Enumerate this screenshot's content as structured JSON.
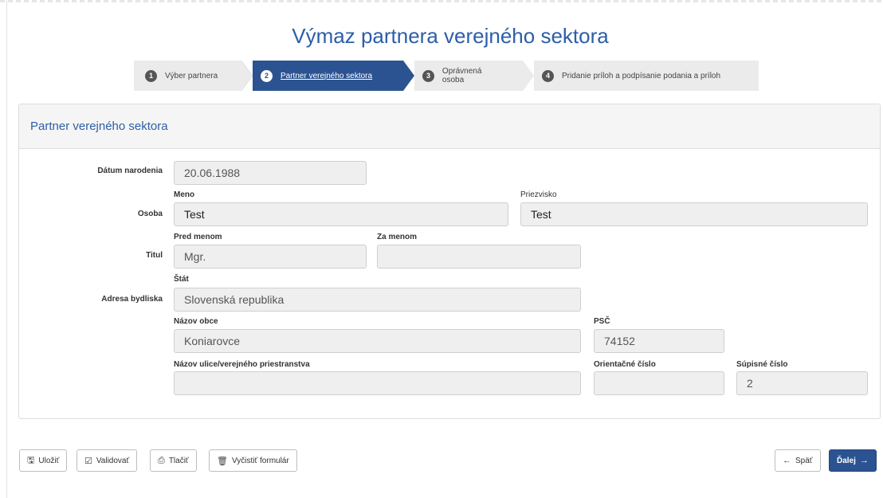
{
  "title": "Výmaz partnera verejného sektora",
  "steps": [
    {
      "num": "1",
      "label": "Výber partnera"
    },
    {
      "num": "2",
      "label": "Partner verejného sektora"
    },
    {
      "num": "3",
      "label": "Oprávnená osoba"
    },
    {
      "num": "4",
      "label": "Pridanie príloh a podpísanie podania a príloh"
    }
  ],
  "section_title": "Partner verejného sektora",
  "form": {
    "birth_date": {
      "label": "Dátum narodenia",
      "value": "20.06.1988"
    },
    "person": {
      "label": "Osoba",
      "first_name_label": "Meno",
      "first_name": "Test",
      "last_name_label": "Priezvisko",
      "last_name": "Test"
    },
    "title": {
      "label": "Titul",
      "before_label": "Pred menom",
      "before": "Mgr.",
      "after_label": "Za menom",
      "after": ""
    },
    "address": {
      "label": "Adresa bydliska",
      "country_label": "Štát",
      "country": "Slovenská republika",
      "municipality_label": "Názov obce",
      "municipality": "Koniarovce",
      "zip_label": "PSČ",
      "zip": "74152",
      "street_label": "Názov ulice/verejného priestranstva",
      "street": "",
      "orientation_no_label": "Orientačné číslo",
      "orientation_no": "",
      "register_no_label": "Súpisné číslo",
      "register_no": "2"
    }
  },
  "buttons": {
    "save": "Uložiť",
    "validate": "Validovať",
    "print": "Tlačiť",
    "clear": "Vyčistiť formulár",
    "back": "Späť",
    "next": "Ďalej"
  },
  "colors": {
    "accent": "#2c5391",
    "title": "#2c5ea8"
  }
}
